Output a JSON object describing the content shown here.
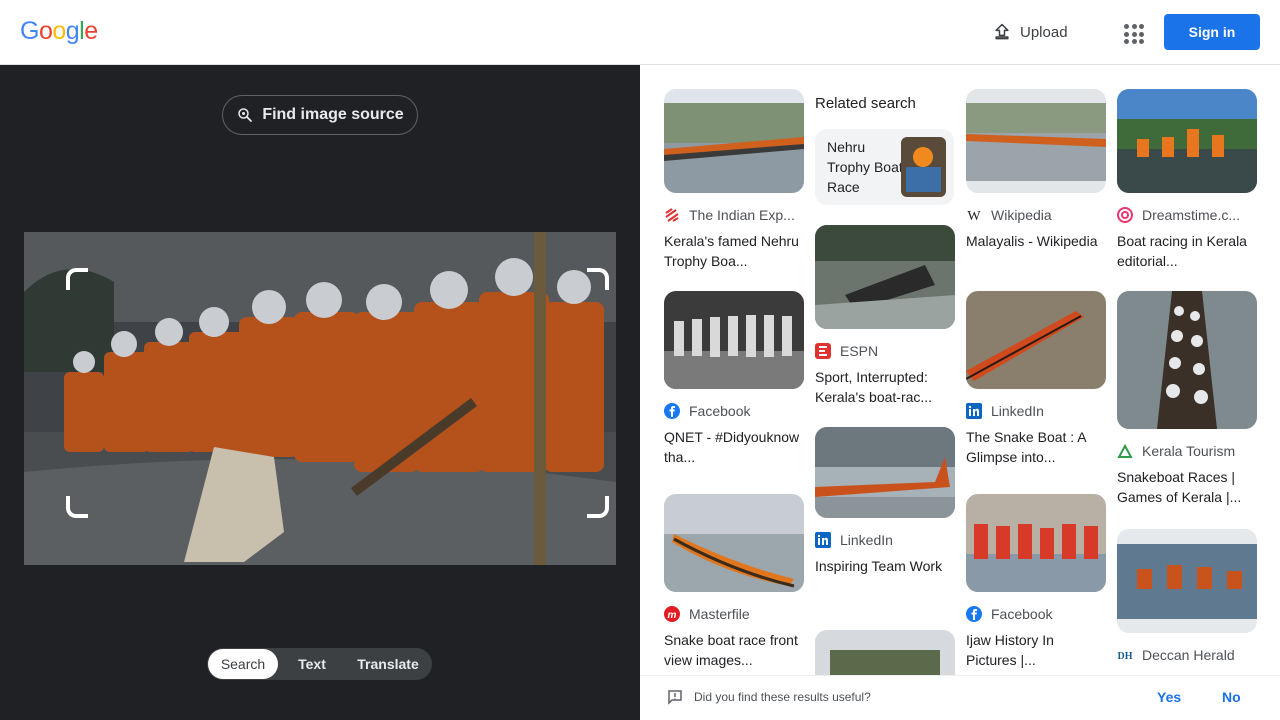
{
  "header": {
    "logo_text": "Google",
    "logo_colors": [
      "#4285F4",
      "#EA4335",
      "#FBBC05",
      "#4285F4",
      "#34A853",
      "#EA4335"
    ],
    "upload_label": "Upload",
    "apps_icon": "apps-grid-icon",
    "signin_label": "Sign in",
    "accent": "#1a73e8"
  },
  "left": {
    "find_source_label": "Find image source",
    "modes": [
      "Search",
      "Text",
      "Translate"
    ],
    "active_mode": "Search",
    "background": "#202124"
  },
  "results": {
    "related_heading": "Related search",
    "related_item": "Nehru Trophy Boat Race",
    "cards": [
      {
        "source": "The Indian Exp...",
        "title": "Kerala's famed Nehru Trophy Boa...",
        "favicon": "indian-express-icon"
      },
      {
        "source": "Facebook",
        "title": "QNET - #Didyouknow tha...",
        "favicon": "facebook-icon"
      },
      {
        "source": "Masterfile",
        "title": "Snake boat race front view images...",
        "favicon": "masterfile-icon"
      },
      {
        "source": "ESPN",
        "title": "Sport, Interrupted: Kerala's boat-rac...",
        "favicon": "espn-icon"
      },
      {
        "source": "LinkedIn",
        "title": "Inspiring Team Work",
        "favicon": "linkedin-icon"
      },
      {
        "source": "Wikipedia",
        "title": "Malayalis - Wikipedia",
        "favicon": "wikipedia-icon"
      },
      {
        "source": "LinkedIn",
        "title": "The Snake Boat : A Glimpse into...",
        "favicon": "linkedin-icon"
      },
      {
        "source": "Facebook",
        "title": "Ijaw History In Pictures |...",
        "favicon": "facebook-icon"
      },
      {
        "source": "Dreamstime.c...",
        "title": "Boat racing in Kerala editorial...",
        "favicon": "dreamstime-icon"
      },
      {
        "source": "Kerala Tourism",
        "title": "Snakeboat Races | Games of Kerala |...",
        "favicon": "kerala-tourism-icon"
      },
      {
        "source": "Deccan Herald",
        "title": "",
        "favicon": "deccan-herald-icon"
      }
    ]
  },
  "feedback": {
    "question": "Did you find these results useful?",
    "yes": "Yes",
    "no": "No"
  }
}
